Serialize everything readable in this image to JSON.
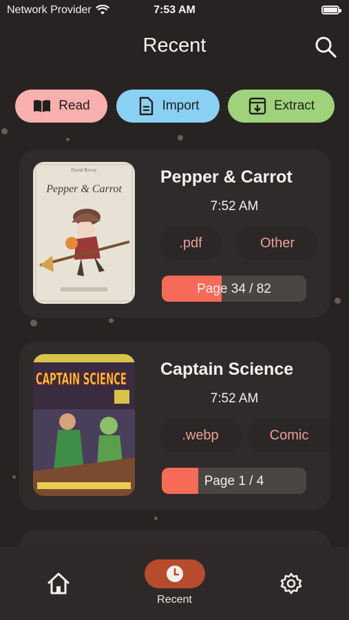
{
  "status_bar": {
    "carrier": "Network Provider",
    "time": "7:53 AM"
  },
  "header": {
    "title": "Recent"
  },
  "actions": {
    "read": "Read",
    "import": "Import",
    "extract": "Extract"
  },
  "books": [
    {
      "title": "Pepper & Carrot",
      "time": "7:52 AM",
      "format": ".pdf",
      "category": "Other",
      "progress_label": "Page 34 / 82",
      "progress": 0.415,
      "cover_title": "Pepper & Carrot",
      "cover_author": "David Revoy"
    },
    {
      "title": "Captain Science",
      "time": "7:52 AM",
      "format": ".webp",
      "category": "Comic",
      "progress_label": "Page 1 / 4",
      "progress": 0.25,
      "cover_title": "CAPTAIN SCIENCE"
    }
  ],
  "tabbar": {
    "recent_label": "Recent"
  },
  "colors": {
    "accent": "#f66a58",
    "tab_active": "#b64b2e",
    "read": "#f7b0ad",
    "import": "#8ad0f3",
    "extract": "#9fd27b"
  }
}
